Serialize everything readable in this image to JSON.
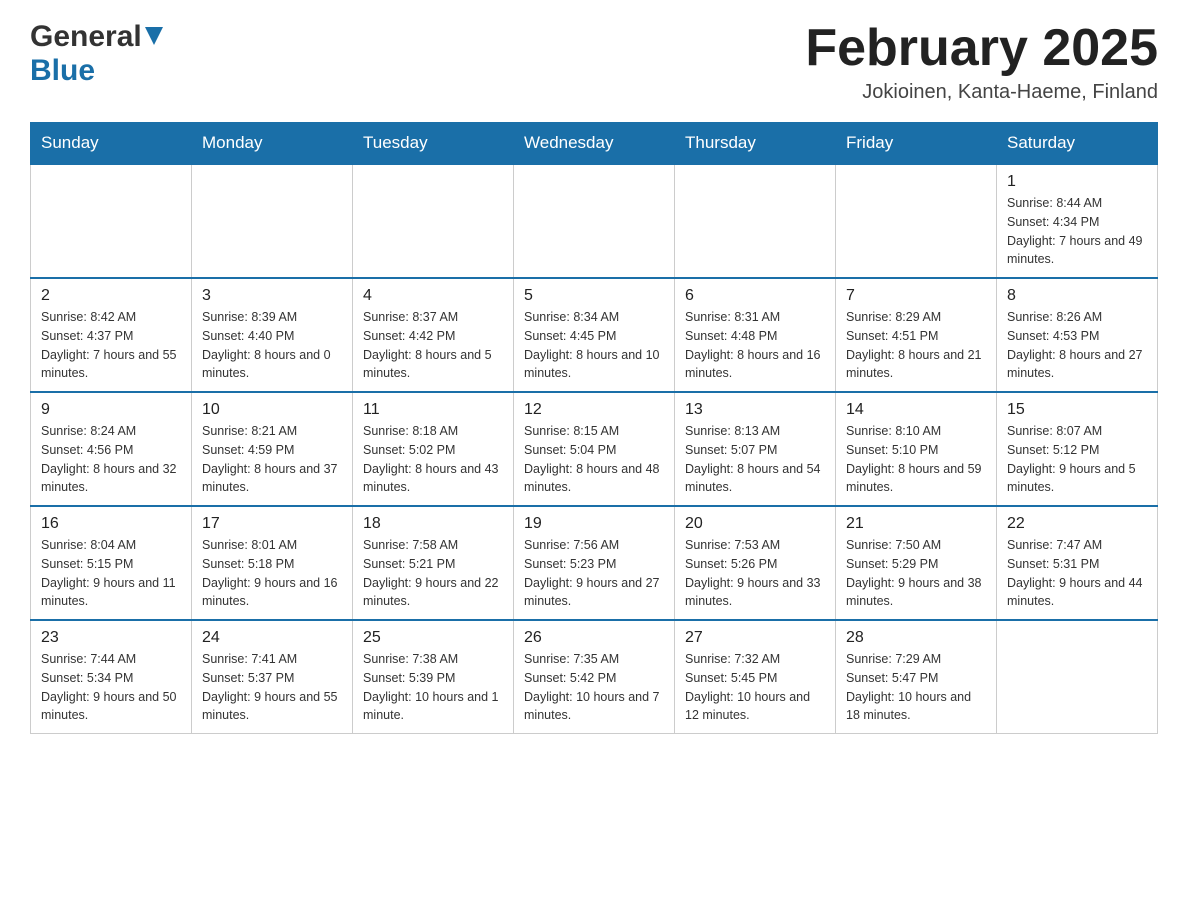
{
  "header": {
    "logo_general": "General",
    "logo_blue": "Blue",
    "title": "February 2025",
    "location": "Jokioinen, Kanta-Haeme, Finland"
  },
  "weekdays": [
    "Sunday",
    "Monday",
    "Tuesday",
    "Wednesday",
    "Thursday",
    "Friday",
    "Saturday"
  ],
  "weeks": [
    {
      "days": [
        {
          "date": "",
          "info": ""
        },
        {
          "date": "",
          "info": ""
        },
        {
          "date": "",
          "info": ""
        },
        {
          "date": "",
          "info": ""
        },
        {
          "date": "",
          "info": ""
        },
        {
          "date": "",
          "info": ""
        },
        {
          "date": "1",
          "info": "Sunrise: 8:44 AM\nSunset: 4:34 PM\nDaylight: 7 hours and 49 minutes."
        }
      ]
    },
    {
      "days": [
        {
          "date": "2",
          "info": "Sunrise: 8:42 AM\nSunset: 4:37 PM\nDaylight: 7 hours and 55 minutes."
        },
        {
          "date": "3",
          "info": "Sunrise: 8:39 AM\nSunset: 4:40 PM\nDaylight: 8 hours and 0 minutes."
        },
        {
          "date": "4",
          "info": "Sunrise: 8:37 AM\nSunset: 4:42 PM\nDaylight: 8 hours and 5 minutes."
        },
        {
          "date": "5",
          "info": "Sunrise: 8:34 AM\nSunset: 4:45 PM\nDaylight: 8 hours and 10 minutes."
        },
        {
          "date": "6",
          "info": "Sunrise: 8:31 AM\nSunset: 4:48 PM\nDaylight: 8 hours and 16 minutes."
        },
        {
          "date": "7",
          "info": "Sunrise: 8:29 AM\nSunset: 4:51 PM\nDaylight: 8 hours and 21 minutes."
        },
        {
          "date": "8",
          "info": "Sunrise: 8:26 AM\nSunset: 4:53 PM\nDaylight: 8 hours and 27 minutes."
        }
      ]
    },
    {
      "days": [
        {
          "date": "9",
          "info": "Sunrise: 8:24 AM\nSunset: 4:56 PM\nDaylight: 8 hours and 32 minutes."
        },
        {
          "date": "10",
          "info": "Sunrise: 8:21 AM\nSunset: 4:59 PM\nDaylight: 8 hours and 37 minutes."
        },
        {
          "date": "11",
          "info": "Sunrise: 8:18 AM\nSunset: 5:02 PM\nDaylight: 8 hours and 43 minutes."
        },
        {
          "date": "12",
          "info": "Sunrise: 8:15 AM\nSunset: 5:04 PM\nDaylight: 8 hours and 48 minutes."
        },
        {
          "date": "13",
          "info": "Sunrise: 8:13 AM\nSunset: 5:07 PM\nDaylight: 8 hours and 54 minutes."
        },
        {
          "date": "14",
          "info": "Sunrise: 8:10 AM\nSunset: 5:10 PM\nDaylight: 8 hours and 59 minutes."
        },
        {
          "date": "15",
          "info": "Sunrise: 8:07 AM\nSunset: 5:12 PM\nDaylight: 9 hours and 5 minutes."
        }
      ]
    },
    {
      "days": [
        {
          "date": "16",
          "info": "Sunrise: 8:04 AM\nSunset: 5:15 PM\nDaylight: 9 hours and 11 minutes."
        },
        {
          "date": "17",
          "info": "Sunrise: 8:01 AM\nSunset: 5:18 PM\nDaylight: 9 hours and 16 minutes."
        },
        {
          "date": "18",
          "info": "Sunrise: 7:58 AM\nSunset: 5:21 PM\nDaylight: 9 hours and 22 minutes."
        },
        {
          "date": "19",
          "info": "Sunrise: 7:56 AM\nSunset: 5:23 PM\nDaylight: 9 hours and 27 minutes."
        },
        {
          "date": "20",
          "info": "Sunrise: 7:53 AM\nSunset: 5:26 PM\nDaylight: 9 hours and 33 minutes."
        },
        {
          "date": "21",
          "info": "Sunrise: 7:50 AM\nSunset: 5:29 PM\nDaylight: 9 hours and 38 minutes."
        },
        {
          "date": "22",
          "info": "Sunrise: 7:47 AM\nSunset: 5:31 PM\nDaylight: 9 hours and 44 minutes."
        }
      ]
    },
    {
      "days": [
        {
          "date": "23",
          "info": "Sunrise: 7:44 AM\nSunset: 5:34 PM\nDaylight: 9 hours and 50 minutes."
        },
        {
          "date": "24",
          "info": "Sunrise: 7:41 AM\nSunset: 5:37 PM\nDaylight: 9 hours and 55 minutes."
        },
        {
          "date": "25",
          "info": "Sunrise: 7:38 AM\nSunset: 5:39 PM\nDaylight: 10 hours and 1 minute."
        },
        {
          "date": "26",
          "info": "Sunrise: 7:35 AM\nSunset: 5:42 PM\nDaylight: 10 hours and 7 minutes."
        },
        {
          "date": "27",
          "info": "Sunrise: 7:32 AM\nSunset: 5:45 PM\nDaylight: 10 hours and 12 minutes."
        },
        {
          "date": "28",
          "info": "Sunrise: 7:29 AM\nSunset: 5:47 PM\nDaylight: 10 hours and 18 minutes."
        },
        {
          "date": "",
          "info": ""
        }
      ]
    }
  ]
}
